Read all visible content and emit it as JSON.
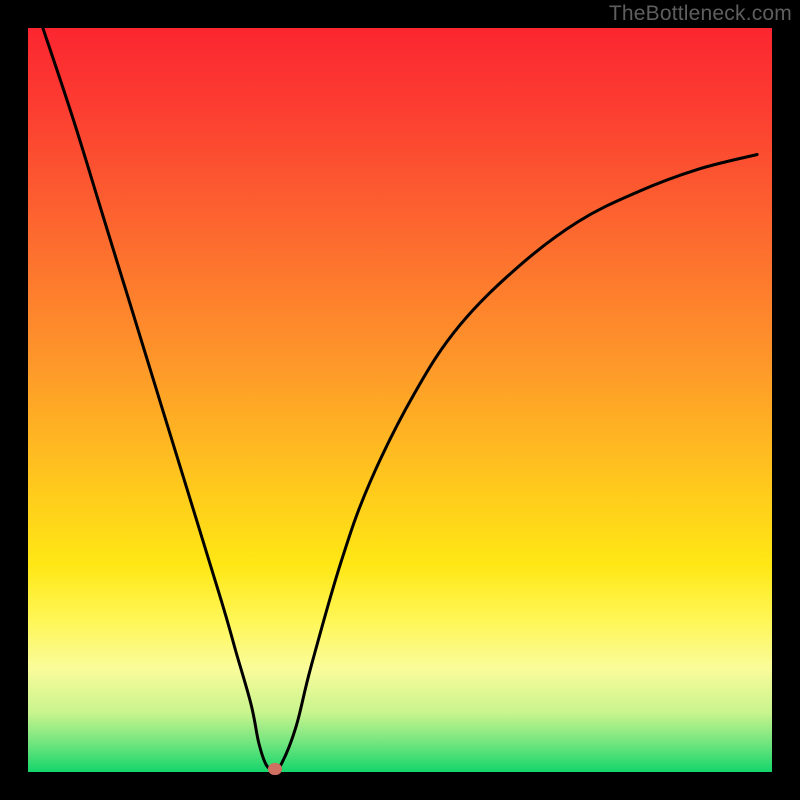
{
  "watermark": "TheBottleneck.com",
  "colors": {
    "curve": "#000000",
    "marker": "#d07062",
    "frame_bg": "#000000"
  },
  "chart_data": {
    "type": "line",
    "title": "",
    "xlabel": "",
    "ylabel": "",
    "xlim": [
      0,
      100
    ],
    "ylim": [
      0,
      100
    ],
    "grid": false,
    "legend": false,
    "series": [
      {
        "name": "bottleneck-curve",
        "x": [
          2,
          6,
          10,
          14,
          18,
          22,
          26,
          28,
          30,
          31,
          32,
          33,
          34,
          36,
          38,
          42,
          46,
          52,
          58,
          66,
          74,
          82,
          90,
          98
        ],
        "y": [
          100,
          88,
          75,
          62,
          49,
          36,
          23,
          16,
          9,
          4,
          1,
          0.4,
          1,
          6,
          14,
          28,
          39,
          51,
          60,
          68,
          74,
          78,
          81,
          83
        ]
      }
    ],
    "marker": {
      "x": 33.2,
      "y": 0.4
    },
    "gradient_stops": [
      {
        "pos": 0,
        "color": "#fb2630"
      },
      {
        "pos": 28,
        "color": "#fd6a2f"
      },
      {
        "pos": 60,
        "color": "#ffc41e"
      },
      {
        "pos": 86,
        "color": "#fafc9a"
      },
      {
        "pos": 100,
        "color": "#14d66b"
      }
    ]
  }
}
